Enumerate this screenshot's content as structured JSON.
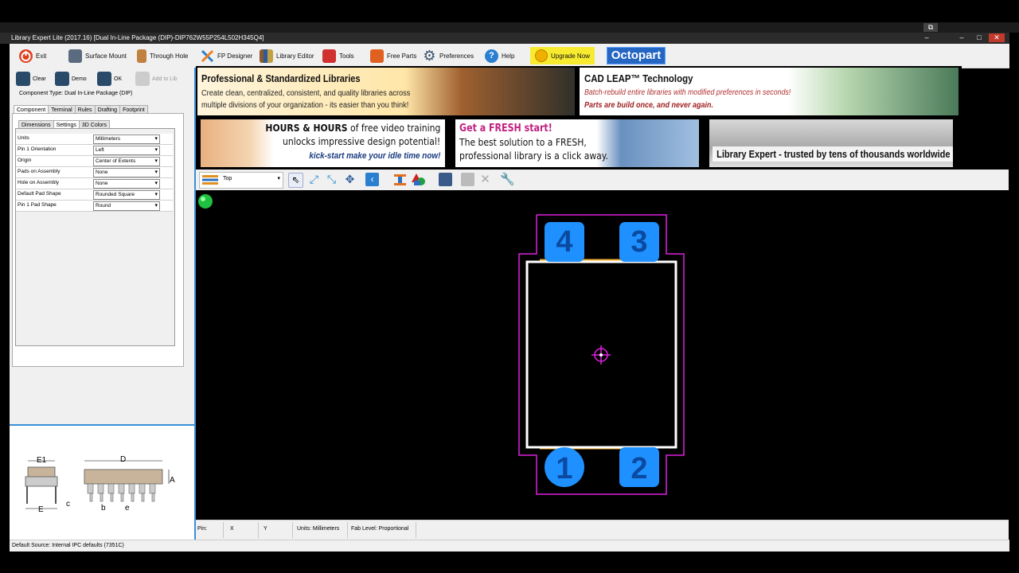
{
  "window": {
    "title": "Library Expert Lite (2017.16) [Dual In-Line Package (DIP)-DIP762W55P254L502H345Q4]"
  },
  "toolbar": {
    "items": [
      {
        "label": "Exit",
        "icon": "power-icon",
        "color": "#e04020"
      },
      {
        "label": "Surface Mount",
        "icon": "chip-icon",
        "color": "#5a6b80"
      },
      {
        "label": "Through Hole",
        "icon": "through-hole-icon",
        "color": "#c08040"
      },
      {
        "label": "FP Designer",
        "icon": "fp-designer-icon",
        "color": "#2a7fd0"
      },
      {
        "label": "Library Editor",
        "icon": "library-editor-icon",
        "color": "#8a5a2a"
      },
      {
        "label": "Tools",
        "icon": "toolbox-icon",
        "color": "#d03030"
      },
      {
        "label": "Free Parts",
        "icon": "cart-icon",
        "color": "#e06020"
      },
      {
        "label": "Preferences",
        "icon": "gear-icon",
        "color": "#3a5070"
      },
      {
        "label": "Help",
        "icon": "help-icon",
        "color": "#2a7fd0"
      }
    ],
    "upgrade_label": "Upgrade Now",
    "octopart_label": "Octopart"
  },
  "left_panel": {
    "buttons": [
      {
        "label": "Clear",
        "icon": "clear-icon"
      },
      {
        "label": "Demo",
        "icon": "demo-icon"
      },
      {
        "label": "OK",
        "icon": "ok-icon"
      },
      {
        "label": "Add to Lib",
        "icon": "add-to-lib-icon"
      }
    ],
    "component_type": "Component Type: Dual In-Line Package (DIP)",
    "tabs": [
      "Component",
      "Terminal",
      "Rules",
      "Drafting",
      "Footprint"
    ],
    "subtabs": [
      "Dimensions",
      "Settings",
      "3D Colors"
    ],
    "settings": [
      {
        "label": "Units",
        "value": "Millimeters"
      },
      {
        "label": "Pin 1 Orientation",
        "value": "Left"
      },
      {
        "label": "Origin",
        "value": "Center of Extents"
      },
      {
        "label": "Pads on Assembly",
        "value": "None"
      },
      {
        "label": "Hole on Assembly",
        "value": "None"
      },
      {
        "label": "Default Pad Shape",
        "value": "Rounded Square"
      },
      {
        "label": "Pin 1 Pad Shape",
        "value": "Round"
      }
    ],
    "diagram_labels": {
      "e1": "E1",
      "e": "E",
      "c": "c",
      "d": "D",
      "a": "A",
      "b": "b",
      "pitch": "e"
    }
  },
  "banners": {
    "b1_title": "Professional & Standardized Libraries",
    "b1_text": "Create clean, centralized, consistent, and quality libraries across multiple divisions of your organization - its easier than you think!",
    "b2_title": "CAD LEAP™ Technology",
    "b2_line1": "Batch-rebuild entire libraries with modified preferences in seconds!",
    "b2_line2": "Parts are build once, and never again.",
    "b3_line1a": "HOURS & HOURS",
    "b3_line1b": " of free video training",
    "b3_line2": "unlocks impressive design potential!",
    "b3_line3": "kick-start make your idle time now!",
    "b4_title": "Get a FRESH start!",
    "b4_line1": "The best solution to a FRESH,",
    "b4_line2": "professional library is a click away.",
    "b5_text": "Library Expert - trusted by tens of thousands worldwide"
  },
  "canvas_toolbar": {
    "layer": "Top"
  },
  "footprint": {
    "pins": [
      "1",
      "2",
      "3",
      "4"
    ],
    "colors": {
      "courtyard": "#e020e0",
      "silkscreen": "#ffffff",
      "pad": "#1e90ff",
      "assembly": "#f0b030",
      "origin": "#e020e0"
    }
  },
  "statusbar": {
    "pin": "Pin:",
    "x": "X",
    "y": "Y",
    "units": "Units: Millimeters",
    "fab": "Fab Level: Proportional"
  },
  "bottom_status": "Default Source:  Internal IPC defaults (7351C)"
}
